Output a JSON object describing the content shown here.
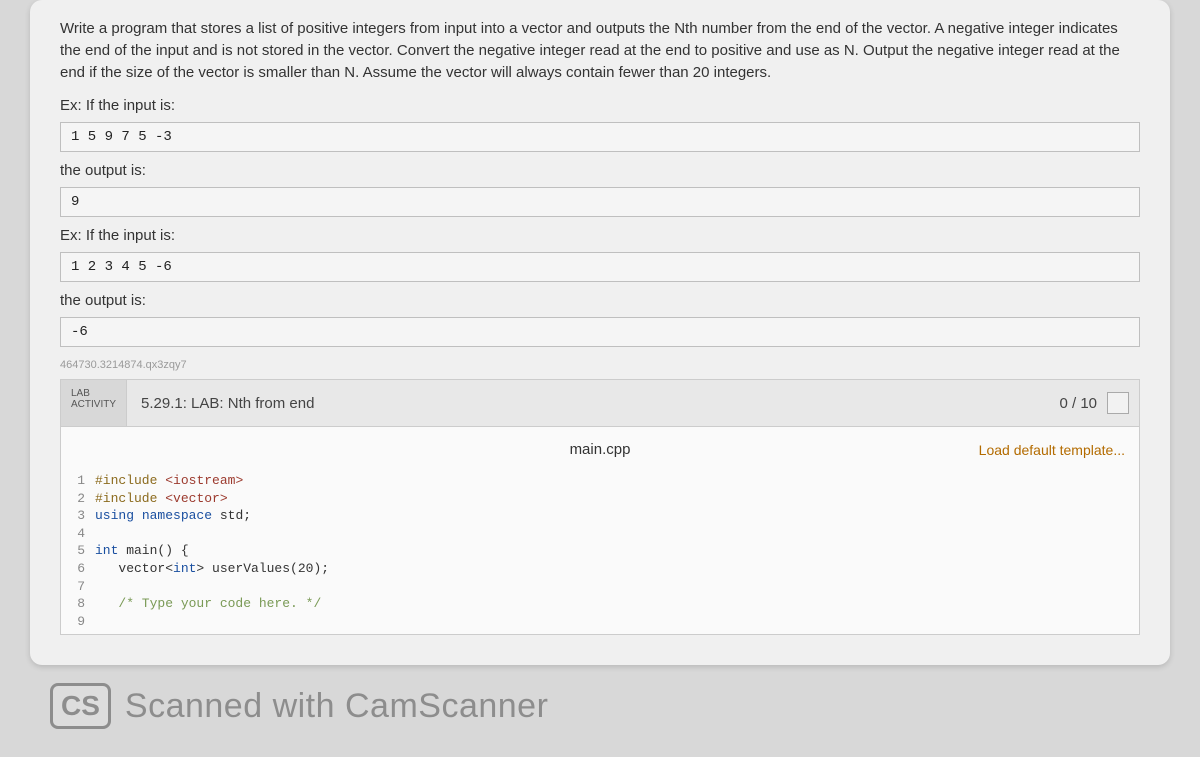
{
  "problem": {
    "description": "Write a program that stores a list of positive integers from input into a vector and outputs the Nth number from the end of the vector. A negative integer indicates the end of the input and is not stored in the vector. Convert the negative integer read at the end to positive and use as N. Output the negative integer read at the end if the size of the vector is smaller than N. Assume the vector will always contain fewer than 20 integers.",
    "ex1_label": "Ex: If the input is:",
    "ex1_input": "1 5 9 7 5 -3",
    "ex1_output_label": "the output is:",
    "ex1_output": "9",
    "ex2_label": "Ex: If the input is:",
    "ex2_input": "1 2 3 4 5 -6",
    "ex2_output_label": "the output is:",
    "ex2_output": "-6"
  },
  "hash_id": "464730.3214874.qx3zqy7",
  "activity": {
    "tab_line1": "LAB",
    "tab_line2": "ACTIVITY",
    "title": "5.29.1: LAB: Nth from end",
    "score": "0 / 10"
  },
  "editor": {
    "filename": "main.cpp",
    "load_template": "Load default template...",
    "lines": [
      {
        "n": "1",
        "html": "<span class='kw-pre'>#include</span> <span class='str'>&lt;iostream&gt;</span>"
      },
      {
        "n": "2",
        "html": "<span class='kw-pre'>#include</span> <span class='str'>&lt;vector&gt;</span>"
      },
      {
        "n": "3",
        "html": "<span class='kw-blue'>using</span> <span class='kw-blue'>namespace</span> std;"
      },
      {
        "n": "4",
        "html": ""
      },
      {
        "n": "5",
        "html": "<span class='kw-blue'>int</span> main() {"
      },
      {
        "n": "6",
        "html": "   vector&lt;<span class='kw-blue'>int</span>&gt; userValues(20);"
      },
      {
        "n": "7",
        "html": ""
      },
      {
        "n": "8",
        "html": "   <span class='cmt'>/* Type your code here. */</span>"
      },
      {
        "n": "9",
        "html": ""
      }
    ]
  },
  "watermark": {
    "badge": "CS",
    "text": "Scanned with CamScanner"
  }
}
